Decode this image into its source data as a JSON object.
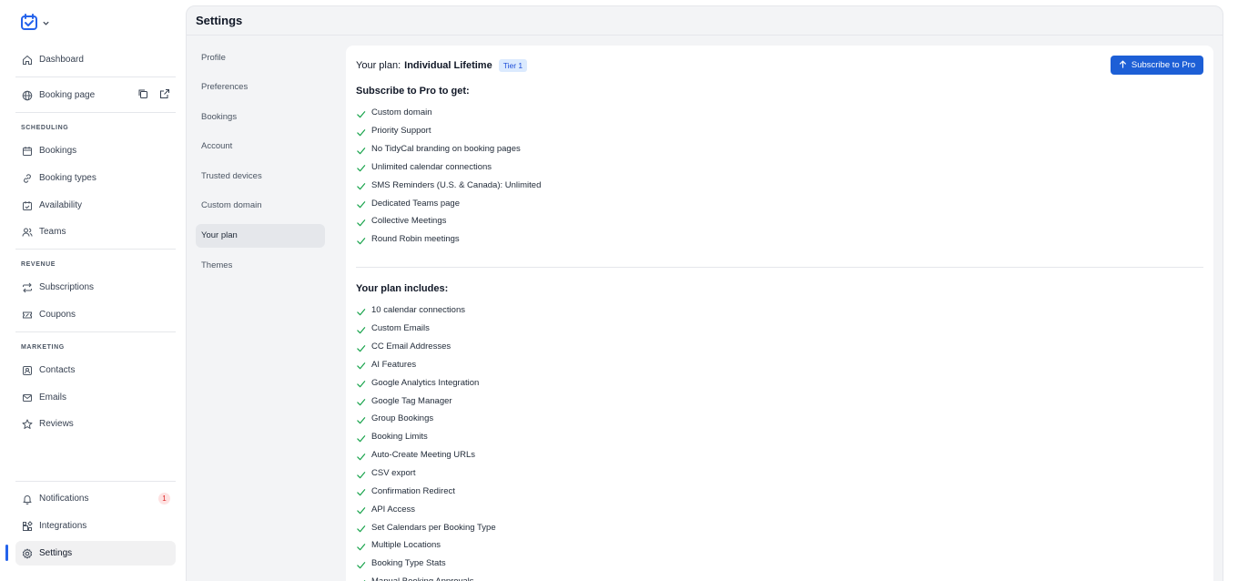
{
  "sidebar": {
    "top_items": [
      {
        "label": "Dashboard",
        "icon": "home-icon"
      },
      {
        "label": "Booking page",
        "icon": "globe-icon"
      }
    ],
    "sections": [
      {
        "title": "SCHEDULING",
        "items": [
          {
            "label": "Bookings",
            "icon": "calendar-icon"
          },
          {
            "label": "Booking types",
            "icon": "link-icon"
          },
          {
            "label": "Availability",
            "icon": "calendar-check-icon"
          },
          {
            "label": "Teams",
            "icon": "users-icon"
          }
        ]
      },
      {
        "title": "REVENUE",
        "items": [
          {
            "label": "Subscriptions",
            "icon": "repeat-icon"
          },
          {
            "label": "Coupons",
            "icon": "ticket-icon"
          }
        ]
      },
      {
        "title": "MARKETING",
        "items": [
          {
            "label": "Contacts",
            "icon": "contact-icon"
          },
          {
            "label": "Emails",
            "icon": "mail-icon"
          },
          {
            "label": "Reviews",
            "icon": "star-icon"
          }
        ]
      }
    ],
    "bottom_items": [
      {
        "label": "Notifications",
        "icon": "bell-icon",
        "badge": "1"
      },
      {
        "label": "Integrations",
        "icon": "puzzle-icon"
      },
      {
        "label": "Settings",
        "icon": "gear-icon"
      }
    ]
  },
  "main": {
    "title": "Settings",
    "settings_nav": [
      "Profile",
      "Preferences",
      "Bookings",
      "Account",
      "Trusted devices",
      "Custom domain",
      "Your plan",
      "Themes"
    ],
    "active_nav": "Your plan",
    "plan": {
      "prefix": "Your plan:",
      "name": "Individual Lifetime",
      "tier": "Tier 1",
      "subscribe_label": "Subscribe to Pro"
    },
    "pro_heading": "Subscribe to Pro to get:",
    "pro_features": [
      "Custom domain",
      "Priority Support",
      "No TidyCal branding on booking pages",
      "Unlimited calendar connections",
      "SMS Reminders (U.S. & Canada): Unlimited",
      "Dedicated Teams page",
      "Collective Meetings",
      "Round Robin meetings"
    ],
    "includes_heading": "Your plan includes:",
    "included_features": [
      "10 calendar connections",
      "Custom Emails",
      "CC Email Addresses",
      "AI Features",
      "Google Analytics Integration",
      "Google Tag Manager",
      "Group Bookings",
      "Booking Limits",
      "Auto-Create Meeting URLs",
      "CSV export",
      "Confirmation Redirect",
      "API Access",
      "Set Calendars per Booking Type",
      "Multiple Locations",
      "Booking Type Stats",
      "Manual Booking Approvals"
    ]
  },
  "colors": {
    "accent": "#1d5fd6",
    "check": "#16a34a",
    "badge_bg": "#fee2e2",
    "badge_text": "#dc2626"
  }
}
